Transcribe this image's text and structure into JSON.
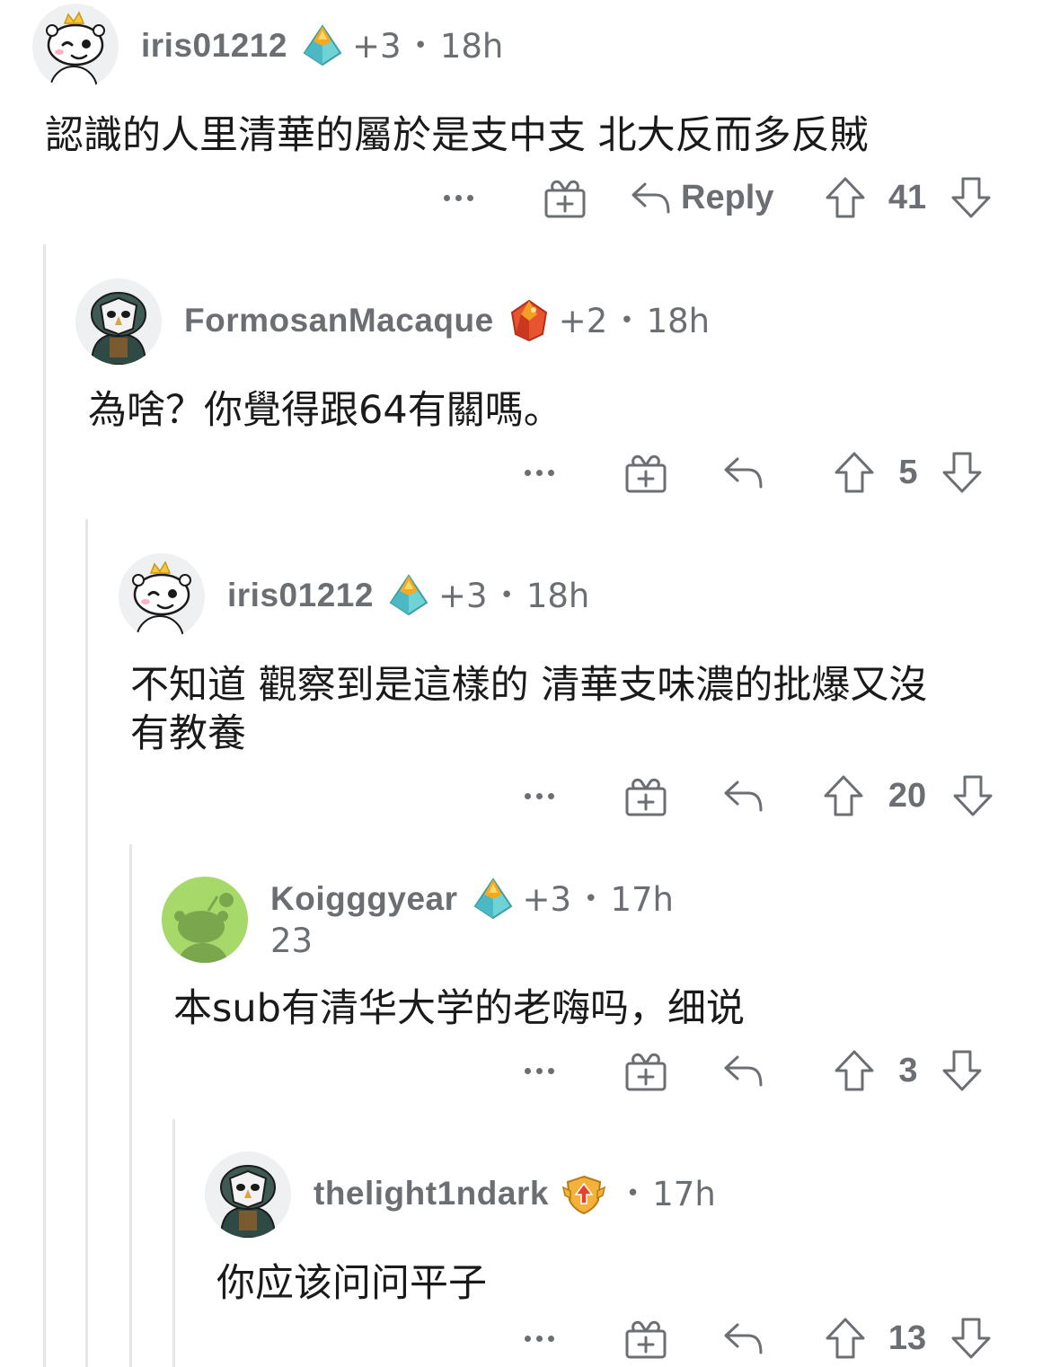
{
  "colors": {
    "text_primary": "#1a1a1b",
    "text_secondary": "#6b6f73",
    "thread_line": "#e6e6e8",
    "koig_avatar_bg": "#a6d96a"
  },
  "comments": [
    {
      "username": "iris01212",
      "flair_count": "+3",
      "time": "18h",
      "second_line": "",
      "body": "認識的人里清華的屬於是支中支 北大反而多反賊",
      "reply_label": "Reply",
      "votes": "41",
      "badge_icon": "diamond-gem-icon",
      "avatar_icon": "snoo-crown-avatar-icon"
    },
    {
      "username": "FormosanMacaque",
      "flair_count": "+2",
      "time": "18h",
      "second_line": "",
      "body": "為啥？你覺得跟64有關嗎。",
      "reply_label": "",
      "votes": "5",
      "badge_icon": "ruby-gem-icon",
      "avatar_icon": "snoo-owl-mask-avatar-icon"
    },
    {
      "username": "iris01212",
      "flair_count": "+3",
      "time": "18h",
      "second_line": "",
      "body": "不知道 觀察到是這樣的 清華支味濃的批爆又沒\n有教養",
      "reply_label": "",
      "votes": "20",
      "badge_icon": "diamond-gem-icon",
      "avatar_icon": "snoo-crown-avatar-icon"
    },
    {
      "username": "Koigggyear",
      "flair_count": "+3",
      "time": "17h",
      "second_line": "23",
      "body": "本sub有清华大学的老嗨吗，细说",
      "reply_label": "",
      "votes": "3",
      "badge_icon": "diamond-gem-icon",
      "avatar_icon": "snoo-default-green-avatar-icon"
    },
    {
      "username": "thelight1ndark",
      "flair_count": "",
      "time": "17h",
      "second_line": "",
      "body": "你应该问问平子",
      "reply_label": "",
      "votes": "13",
      "badge_icon": "gold-shield-badge-icon",
      "avatar_icon": "snoo-owl-mask-avatar-icon"
    }
  ]
}
